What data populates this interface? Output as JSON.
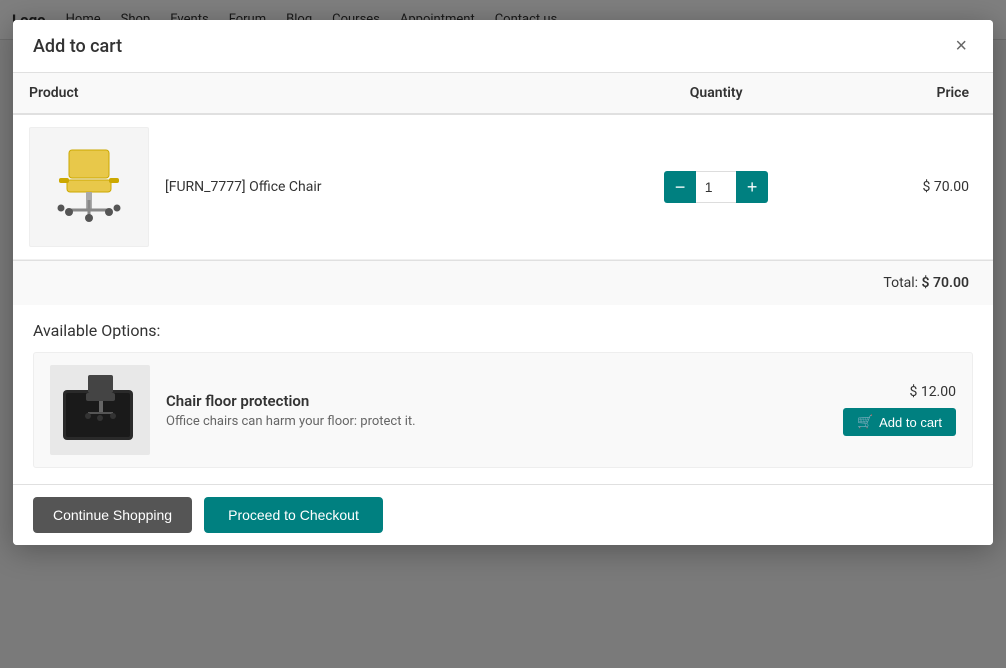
{
  "nav": {
    "items": [
      "Home",
      "Shop",
      "Events",
      "Forum",
      "Blog",
      "Courses",
      "Appointment",
      "Contact us"
    ]
  },
  "modal": {
    "title": "Add to cart",
    "close_label": "×",
    "table": {
      "headers": {
        "product": "Product",
        "quantity": "Quantity",
        "price": "Price"
      },
      "rows": [
        {
          "product_code": "[FURN_7777] Office Chair",
          "quantity": 1,
          "price": "$ 70.00"
        }
      ]
    },
    "total_label": "Total:",
    "total_amount": "$ 70.00",
    "options_title": "Available Options:",
    "options": [
      {
        "name": "Chair floor protection",
        "description": "Office chairs can harm your floor: protect it.",
        "price": "$ 12.00",
        "add_to_cart_label": "Add to cart"
      }
    ],
    "footer": {
      "continue_label": "Continue Shopping",
      "checkout_label": "Proceed to Checkout"
    }
  },
  "colors": {
    "teal": "#008080",
    "dark_btn": "#555555"
  }
}
